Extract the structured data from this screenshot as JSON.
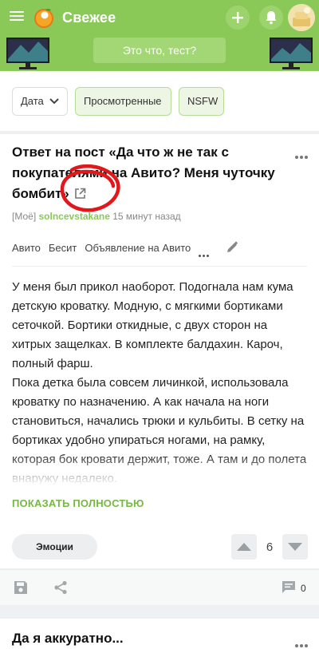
{
  "header": {
    "menu_icon": "hamburger-menu-icon",
    "logo_icon": "peach-logo-icon",
    "title": "Свежее",
    "add_icon": "plus-icon",
    "bell_icon": "bell-icon",
    "accent_color": "#8ac858"
  },
  "banner": {
    "button_label": "Это что, тест?"
  },
  "filters": {
    "date_label": "Дата",
    "viewed_label": "Просмотренные",
    "nsfw_label": "NSFW"
  },
  "post": {
    "title": "Ответ на пост «Да что ж не так с покупателями на Авито? Меня чуточку бомбит»",
    "community_prefix": "[Моё]",
    "author": "solncevstakane",
    "time": "15 минут назад",
    "tags": [
      "Авито",
      "Бесит",
      "Объявление на Авито"
    ],
    "body_paragraphs": [
      "У меня был прикол наоборот. Подогнала нам кума детскую кроватку. Модную, с мягкими бортиками сеточкой. Бортики откидные, с двух сторон на хитрых защелках. В комплекте балдахин. Кароч, полный фарш.",
      "Пока детка была совсем личинкой, использовала кроватку по назначению. А как начала на ноги становиться, начались трюки и кульбиты. В сетку на бортиках удобно упираться ногами, на рамку, которая бок кровати держит, тоже. А там и до полета внаружу недалеко."
    ],
    "show_more_label": "ПОКАЗАТЬ ПОЛНОСТЬЮ",
    "emotions_label": "Эмоции",
    "rating": "6",
    "comments_count": "0"
  },
  "next_post": {
    "title": "Да я аккуратно..."
  }
}
